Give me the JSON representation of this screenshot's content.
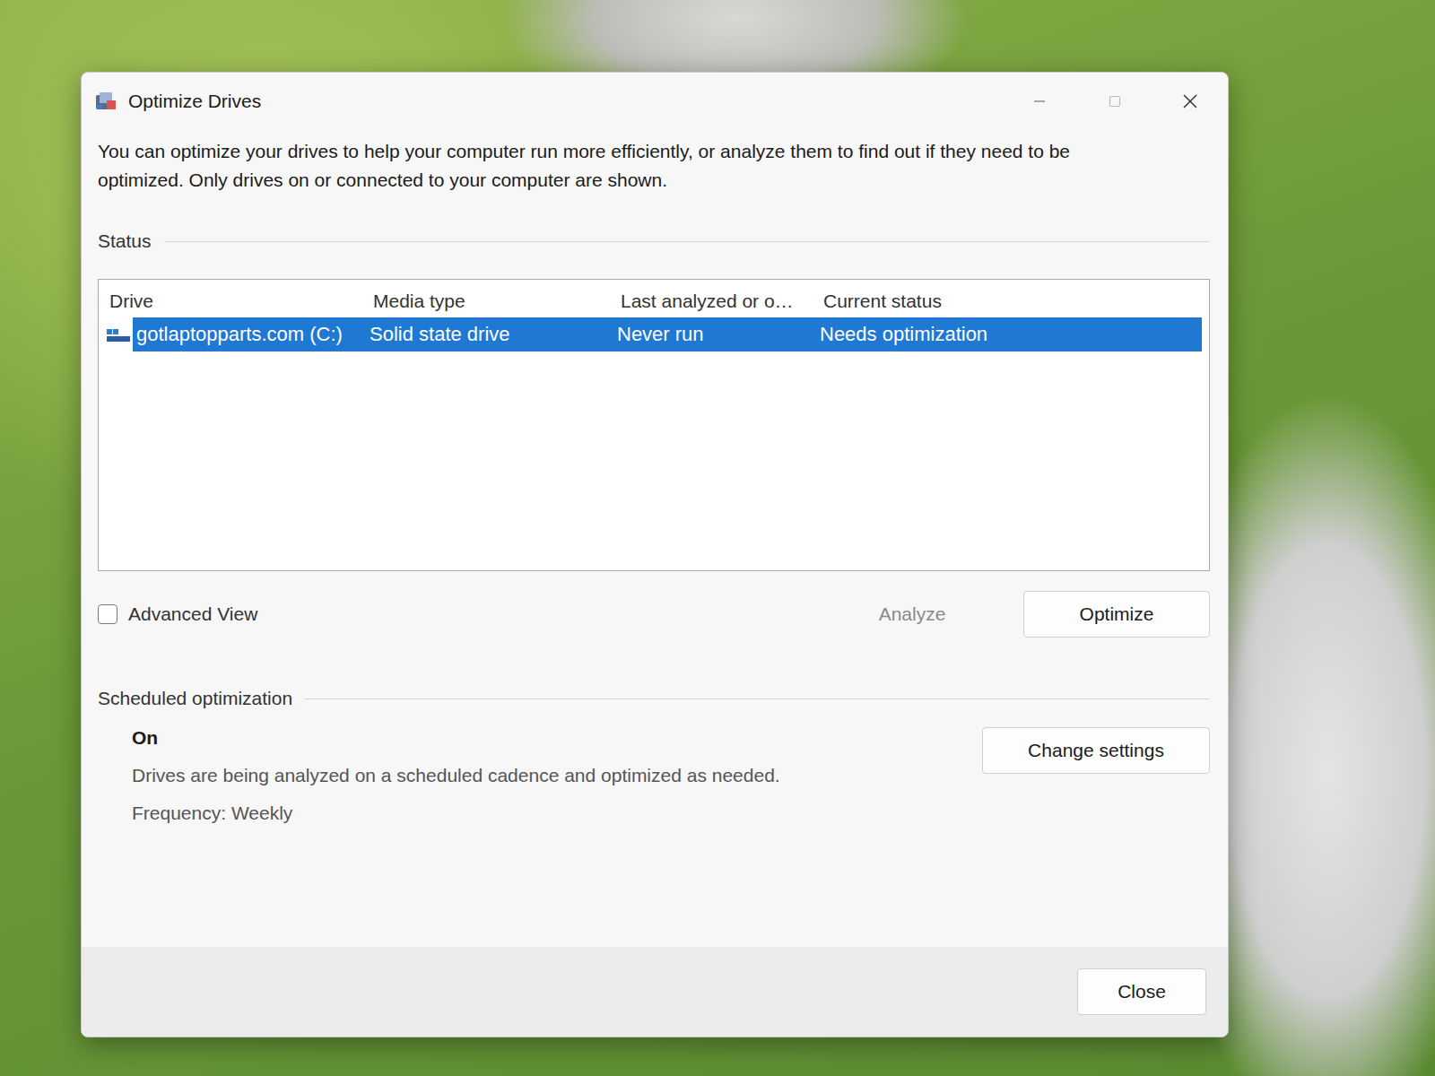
{
  "window": {
    "title": "Optimize Drives"
  },
  "description": "You can optimize your drives to help your computer run more efficiently, or analyze them to find out if they need to be optimized. Only drives on or connected to your computer are shown.",
  "status": {
    "label": "Status"
  },
  "table": {
    "columns": [
      "Drive",
      "Media type",
      "Last analyzed or o…",
      "Current status"
    ],
    "rows": [
      {
        "drive": "gotlaptopparts.com (C:)",
        "media_type": "Solid state drive",
        "last_run": "Never run",
        "status": "Needs optimization",
        "selected": true
      }
    ]
  },
  "advanced_view": {
    "label": "Advanced View",
    "checked": false
  },
  "actions": [
    {
      "label": "Analyze",
      "disabled": true
    },
    {
      "label": "Optimize",
      "disabled": false
    }
  ],
  "scheduled": {
    "label": "Scheduled optimization",
    "state": "On",
    "description": "Drives are being analyzed on a scheduled cadence and optimized as needed.",
    "frequency": "Frequency: Weekly",
    "button": "Change settings"
  },
  "close_button": "Close"
}
